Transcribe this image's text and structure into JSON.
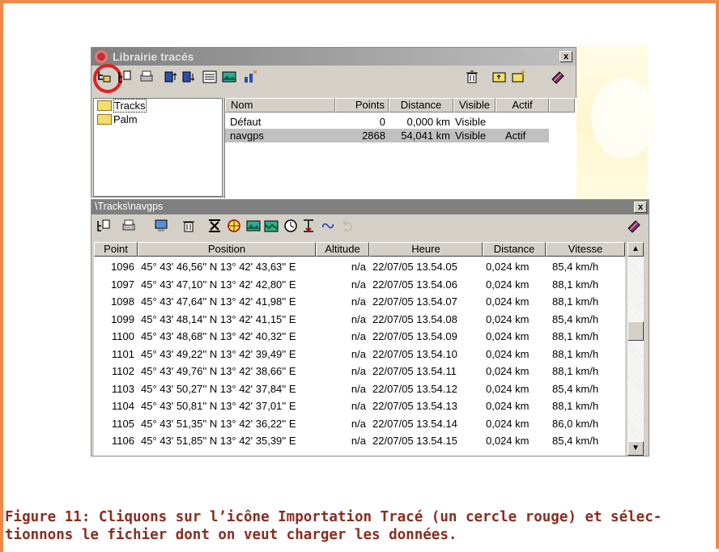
{
  "library_window": {
    "title": "Librairie tracés",
    "close_label": "x",
    "tree": [
      {
        "label": "Tracks"
      },
      {
        "label": "Palm"
      }
    ],
    "columns": [
      "Nom",
      "Points",
      "Distance",
      "Visible",
      "Actif"
    ],
    "rows": [
      {
        "nom": "Défaut",
        "points": "0",
        "distance": "0,000 km",
        "visible": "Visible",
        "actif": ""
      },
      {
        "nom": "navgps",
        "points": "2868",
        "distance": "54,041 km",
        "visible": "Visible",
        "actif": "Actif"
      }
    ]
  },
  "points_window": {
    "title": "\\Tracks\\navgps",
    "close_label": "x",
    "columns": [
      "Point",
      "Position",
      "Altitude",
      "Heure",
      "Distance",
      "Vitesse"
    ],
    "rows": [
      [
        "1096",
        "45° 43' 46,56'' N 13° 42' 43,63'' E",
        "n/a",
        "22/07/05 13.54.05",
        "0,024 km",
        "85,4 km/h"
      ],
      [
        "1097",
        "45° 43' 47,10'' N 13° 42' 42,80'' E",
        "n/a",
        "22/07/05 13.54.06",
        "0,024 km",
        "88,1 km/h"
      ],
      [
        "1098",
        "45° 43' 47,64'' N 13° 42' 41,98'' E",
        "n/a",
        "22/07/05 13.54.07",
        "0,024 km",
        "88,1 km/h"
      ],
      [
        "1099",
        "45° 43' 48,14'' N 13° 42' 41,15'' E",
        "n/a",
        "22/07/05 13.54.08",
        "0,024 km",
        "85,4 km/h"
      ],
      [
        "1100",
        "45° 43' 48,68'' N 13° 42' 40,32'' E",
        "n/a",
        "22/07/05 13.54.09",
        "0,024 km",
        "88,1 km/h"
      ],
      [
        "1101",
        "45° 43' 49,22'' N 13° 42' 39,49'' E",
        "n/a",
        "22/07/05 13.54.10",
        "0,024 km",
        "88,1 km/h"
      ],
      [
        "1102",
        "45° 43' 49,76'' N 13° 42' 38,66'' E",
        "n/a",
        "22/07/05 13.54.11",
        "0,024 km",
        "88,1 km/h"
      ],
      [
        "1103",
        "45° 43' 50,27'' N 13° 42' 37,84'' E",
        "n/a",
        "22/07/05 13.54.12",
        "0,024 km",
        "85,4 km/h"
      ],
      [
        "1104",
        "45° 43' 50,81'' N 13° 42' 37,01'' E",
        "n/a",
        "22/07/05 13.54.13",
        "0,024 km",
        "88,1 km/h"
      ],
      [
        "1105",
        "45° 43' 51,35'' N 13° 42' 36,22'' E",
        "n/a",
        "22/07/05 13.54.14",
        "0,024 km",
        "86,0 km/h"
      ],
      [
        "1106",
        "45° 43' 51,85'' N 13° 42' 35,39'' E",
        "n/a",
        "22/07/05 13.54.15",
        "0,024 km",
        "85,4 km/h"
      ]
    ]
  },
  "caption": {
    "line1": "Figure 11: Cliquons sur l’icône Importation Tracé (un cercle rouge) et sélec-",
    "line2": "tionnons le fichier dont on veut charger les données."
  },
  "colors": {
    "frame": "#f08a4b",
    "caption": "#8a2c1e",
    "highlight_circle": "#e02020"
  },
  "icons": {
    "library_toolbar": [
      "import-track-icon",
      "new-track-icon",
      "print-icon",
      "upload-icon",
      "download-icon",
      "list-icon",
      "map-icon",
      "profile-icon",
      "trash-icon",
      "folder-up-icon",
      "new-folder-icon",
      "book-icon"
    ],
    "points_toolbar": [
      "new-track-icon",
      "print-icon",
      "monitor-icon",
      "trash-icon",
      "filter-icon",
      "globe-icon",
      "map-icon",
      "profile-icon",
      "clock-icon",
      "altitude-icon",
      "link-icon",
      "undo-icon",
      "book-icon"
    ]
  }
}
